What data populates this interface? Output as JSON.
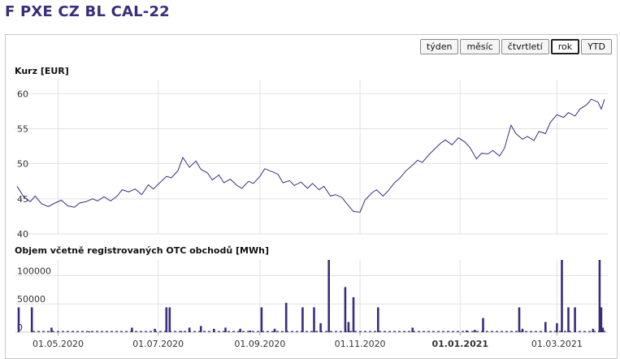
{
  "title": "F PXE CZ BL CAL-22",
  "range_buttons": [
    {
      "label": "týden",
      "active": false
    },
    {
      "label": "měsíc",
      "active": false
    },
    {
      "label": "čtvrtletí",
      "active": false
    },
    {
      "label": "rok",
      "active": true
    },
    {
      "label": "YTD",
      "active": false
    }
  ],
  "colors": {
    "line": "#3a2d7d",
    "bar": "#3a2d7d",
    "grid": "#e2e2e2",
    "title": "#3a2d7d"
  },
  "chart_data": [
    {
      "type": "line",
      "ylabel": "Kurz [EUR]",
      "ylim": [
        40,
        62
      ],
      "yticks": [
        40,
        45,
        50,
        55,
        60
      ],
      "grid": true,
      "x_range": [
        "2020-04-05",
        "2021-04-01"
      ],
      "series": [
        {
          "values": [
            [
              "2020-04-06",
              46.8
            ],
            [
              "2020-04-10",
              45.3
            ],
            [
              "2020-04-14",
              44.6
            ],
            [
              "2020-04-17",
              45.4
            ],
            [
              "2020-04-21",
              44.3
            ],
            [
              "2020-04-25",
              43.9
            ],
            [
              "2020-04-29",
              44.4
            ],
            [
              "2020-05-03",
              44.8
            ],
            [
              "2020-05-07",
              44.0
            ],
            [
              "2020-05-11",
              43.8
            ],
            [
              "2020-05-14",
              44.4
            ],
            [
              "2020-05-18",
              44.6
            ],
            [
              "2020-05-22",
              45.0
            ],
            [
              "2020-05-25",
              44.7
            ],
            [
              "2020-05-29",
              45.3
            ],
            [
              "2020-06-02",
              44.7
            ],
            [
              "2020-06-06",
              45.4
            ],
            [
              "2020-06-09",
              46.3
            ],
            [
              "2020-06-13",
              46.0
            ],
            [
              "2020-06-17",
              46.4
            ],
            [
              "2020-06-21",
              45.6
            ],
            [
              "2020-06-25",
              47.0
            ],
            [
              "2020-06-28",
              46.4
            ],
            [
              "2020-07-02",
              47.3
            ],
            [
              "2020-07-06",
              48.2
            ],
            [
              "2020-07-09",
              48.0
            ],
            [
              "2020-07-13",
              49.0
            ],
            [
              "2020-07-16",
              50.9
            ],
            [
              "2020-07-20",
              49.5
            ],
            [
              "2020-07-24",
              50.4
            ],
            [
              "2020-07-27",
              49.2
            ],
            [
              "2020-07-31",
              48.7
            ],
            [
              "2020-08-03",
              47.7
            ],
            [
              "2020-08-07",
              48.4
            ],
            [
              "2020-08-10",
              47.3
            ],
            [
              "2020-08-14",
              47.8
            ],
            [
              "2020-08-18",
              46.9
            ],
            [
              "2020-08-21",
              46.5
            ],
            [
              "2020-08-25",
              47.5
            ],
            [
              "2020-08-28",
              47.2
            ],
            [
              "2020-09-01",
              48.2
            ],
            [
              "2020-09-04",
              49.3
            ],
            [
              "2020-09-08",
              48.9
            ],
            [
              "2020-09-12",
              48.5
            ],
            [
              "2020-09-15",
              47.3
            ],
            [
              "2020-09-19",
              47.6
            ],
            [
              "2020-09-22",
              46.9
            ],
            [
              "2020-09-26",
              47.4
            ],
            [
              "2020-09-30",
              46.5
            ],
            [
              "2020-10-03",
              47.2
            ],
            [
              "2020-10-07",
              46.3
            ],
            [
              "2020-10-10",
              46.8
            ],
            [
              "2020-10-14",
              45.4
            ],
            [
              "2020-10-17",
              45.6
            ],
            [
              "2020-10-21",
              45.2
            ],
            [
              "2020-10-24",
              44.3
            ],
            [
              "2020-10-28",
              43.2
            ],
            [
              "2020-11-01",
              43.1
            ],
            [
              "2020-11-04",
              44.8
            ],
            [
              "2020-11-08",
              45.8
            ],
            [
              "2020-11-11",
              46.3
            ],
            [
              "2020-11-15",
              45.4
            ],
            [
              "2020-11-18",
              46.1
            ],
            [
              "2020-11-22",
              47.3
            ],
            [
              "2020-11-25",
              47.9
            ],
            [
              "2020-11-29",
              49.0
            ],
            [
              "2020-12-02",
              49.6
            ],
            [
              "2020-12-06",
              50.5
            ],
            [
              "2020-12-09",
              50.2
            ],
            [
              "2020-12-13",
              51.3
            ],
            [
              "2020-12-16",
              52.0
            ],
            [
              "2020-12-20",
              52.9
            ],
            [
              "2020-12-23",
              53.4
            ],
            [
              "2020-12-27",
              52.7
            ],
            [
              "2020-12-31",
              53.7
            ],
            [
              "2021-01-04",
              53.1
            ],
            [
              "2021-01-07",
              52.3
            ],
            [
              "2021-01-11",
              50.7
            ],
            [
              "2021-01-14",
              51.5
            ],
            [
              "2021-01-18",
              51.4
            ],
            [
              "2021-01-21",
              51.9
            ],
            [
              "2021-01-25",
              51.1
            ],
            [
              "2021-01-28",
              52.2
            ],
            [
              "2021-02-01",
              55.5
            ],
            [
              "2021-02-04",
              54.3
            ],
            [
              "2021-02-08",
              53.5
            ],
            [
              "2021-02-11",
              53.9
            ],
            [
              "2021-02-15",
              53.3
            ],
            [
              "2021-02-18",
              54.6
            ],
            [
              "2021-02-22",
              54.3
            ],
            [
              "2021-02-25",
              55.9
            ],
            [
              "2021-03-01",
              57.0
            ],
            [
              "2021-03-05",
              56.6
            ],
            [
              "2021-03-08",
              57.3
            ],
            [
              "2021-03-12",
              56.8
            ],
            [
              "2021-03-15",
              57.8
            ],
            [
              "2021-03-19",
              58.4
            ],
            [
              "2021-03-22",
              59.2
            ],
            [
              "2021-03-26",
              58.8
            ],
            [
              "2021-03-28",
              57.8
            ],
            [
              "2021-03-30",
              59.2
            ]
          ]
        }
      ]
    },
    {
      "type": "bar",
      "ylabel": "Objem včetně registrovaných OTC obchodů [MWh]",
      "ylim": [
        0,
        128000
      ],
      "yticks": [
        0,
        50000,
        100000
      ],
      "grid": true,
      "x_range": [
        "2020-04-05",
        "2021-04-01"
      ],
      "xticks": [
        {
          "label": "01.05.2020",
          "bold": false
        },
        {
          "label": "01.07.2020",
          "bold": false
        },
        {
          "label": "01.09.2020",
          "bold": false
        },
        {
          "label": "01.11.2020",
          "bold": false
        },
        {
          "label": "01.01.2021",
          "bold": true
        },
        {
          "label": "01.03.2021",
          "bold": false
        }
      ],
      "xtick_dates": [
        "2020-05-01",
        "2020-07-01",
        "2020-09-01",
        "2020-11-01",
        "2021-01-01",
        "2021-03-01"
      ],
      "values": [
        [
          "2020-04-07",
          44000
        ],
        [
          "2020-04-15",
          44000
        ],
        [
          "2020-04-27",
          8000
        ],
        [
          "2020-05-10",
          1000
        ],
        [
          "2020-05-20",
          1500
        ],
        [
          "2020-06-15",
          8000
        ],
        [
          "2020-06-29",
          6000
        ],
        [
          "2020-07-06",
          44000
        ],
        [
          "2020-07-08",
          44000
        ],
        [
          "2020-07-15",
          2000
        ],
        [
          "2020-07-20",
          8000
        ],
        [
          "2020-07-27",
          11000
        ],
        [
          "2020-08-04",
          6000
        ],
        [
          "2020-08-11",
          8000
        ],
        [
          "2020-08-20",
          6000
        ],
        [
          "2020-08-26",
          3000
        ],
        [
          "2020-09-02",
          44000
        ],
        [
          "2020-09-10",
          6000
        ],
        [
          "2020-09-17",
          52000
        ],
        [
          "2020-09-27",
          44000
        ],
        [
          "2020-10-04",
          44000
        ],
        [
          "2020-10-08",
          16000
        ],
        [
          "2020-10-13",
          128000
        ],
        [
          "2020-10-23",
          80000
        ],
        [
          "2020-10-25",
          18000
        ],
        [
          "2020-10-28",
          62000
        ],
        [
          "2020-11-12",
          44000
        ],
        [
          "2020-12-03",
          8000
        ],
        [
          "2021-01-05",
          3000
        ],
        [
          "2021-01-10",
          4000
        ],
        [
          "2021-01-15",
          25000
        ],
        [
          "2021-02-06",
          44000
        ],
        [
          "2021-02-08",
          6000
        ],
        [
          "2021-02-22",
          18000
        ],
        [
          "2021-03-01",
          16000
        ],
        [
          "2021-03-04",
          128000
        ],
        [
          "2021-03-08",
          44000
        ],
        [
          "2021-03-12",
          44000
        ],
        [
          "2021-03-23",
          6000
        ],
        [
          "2021-03-27",
          128000
        ],
        [
          "2021-03-28",
          44000
        ],
        [
          "2021-03-29",
          8000
        ]
      ]
    }
  ]
}
